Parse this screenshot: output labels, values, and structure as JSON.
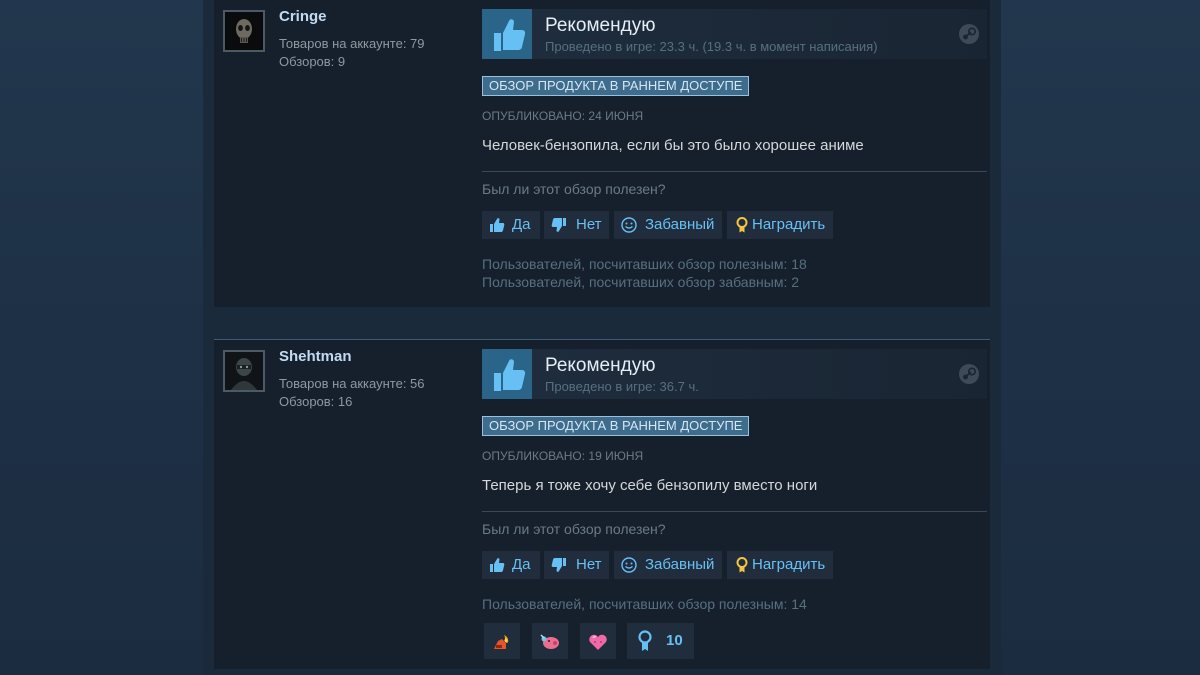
{
  "reviews": [
    {
      "author": {
        "name": "Cringe",
        "products": "Товаров на аккаунте: 79",
        "reviews": "Обзоров: 9"
      },
      "recommendation": "Рекомендую",
      "playtime": "Проведено в игре: 23.3 ч. (19.3 ч. в момент написания)",
      "early_access_badge": "ОБЗОР ПРОДУКТА В РАННЕМ ДОСТУПЕ",
      "posted": "ОПУБЛИКОВАНО: 24 ИЮНЯ",
      "text": "Человек-бензопила, если бы это было хорошее аниме",
      "helpful_question": "Был ли этот обзор полезен?",
      "buttons": {
        "yes": "Да",
        "no": "Нет",
        "funny": "Забавный",
        "award": "Наградить"
      },
      "helpful_count": "Пользователей, посчитавших обзор полезным: 18",
      "funny_count": "Пользователей, посчитавших обзор забавным: 2"
    },
    {
      "author": {
        "name": "Shehtman",
        "products": "Товаров на аккаунте: 56",
        "reviews": "Обзоров: 16"
      },
      "recommendation": "Рекомендую",
      "playtime": "Проведено в игре: 36.7 ч.",
      "early_access_badge": "ОБЗОР ПРОДУКТА В РАННЕМ ДОСТУПЕ",
      "posted": "ОПУБЛИКОВАНО: 19 ИЮНЯ",
      "text": "Теперь я тоже хочу себе бензопилу вместо ноги",
      "helpful_question": "Был ли этот обзор полезен?",
      "buttons": {
        "yes": "Да",
        "no": "Нет",
        "funny": "Забавный",
        "award": "Наградить"
      },
      "helpful_count": "Пользователей, посчитавших обзор полезным: 14",
      "awards": [
        {
          "icon": "hot-take-award-icon"
        },
        {
          "icon": "pig-award-icon"
        },
        {
          "icon": "heart-award-icon"
        },
        {
          "icon": "ribbon-award-icon",
          "count": "10"
        }
      ]
    }
  ],
  "colors": {
    "page_bg": "#1b2838",
    "card_bg": "#16202d",
    "link_blue": "#66c0f4",
    "author_name": "#c1dbf4",
    "thumb_box": "#2a6488"
  }
}
